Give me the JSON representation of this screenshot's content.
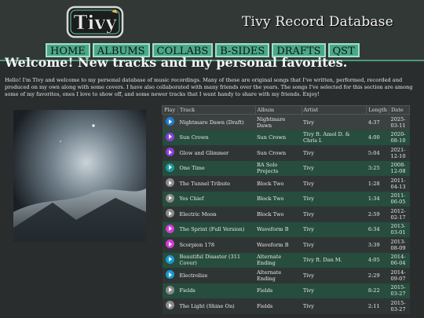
{
  "header": {
    "logo_text": "Tivy",
    "site_title": "Tivy Record Database",
    "nav": [
      "HOME",
      "ALBUMS",
      "COLLABS",
      "B-SIDES",
      "DRAFTS",
      "QST"
    ]
  },
  "welcome_heading": "Welcome! New tracks and my personal favorites.",
  "intro_text": "Hello! I'm Tivy and welcome to my personal database of music recordings. Many of these are original songs that I've written, performed, recorded and produced on my own along with some covers. I have also collaborated with many friends over the years. The songs I've selected for this section are among some of my favorites, ones I love to show off, and some newer tracks that I want handy to share with my friends. Enjoy!",
  "table": {
    "headers": [
      "Play",
      "Track",
      "Album",
      "Artist",
      "Length",
      "Date"
    ],
    "rows": [
      {
        "track": "Nightmare Dawn (Draft)",
        "album": "Nightmare Dawn",
        "artist": "Tivy",
        "length": "4:37",
        "date": "2025-03-11",
        "icon_color": "#1e7fd0",
        "icon": "cover-art-icon"
      },
      {
        "track": "Sun Crown",
        "album": "Sun Crown",
        "artist": "Tivy ft. Amol D. & Chris I.",
        "length": "4:00",
        "date": "2020-08-10",
        "icon_color": "#8a3fd6",
        "icon": "play-icon"
      },
      {
        "track": "Glow and Glimmer",
        "album": "Sun Crown",
        "artist": "Tivy",
        "length": "5:04",
        "date": "2021-12-10",
        "icon_color": "#8a3fd6",
        "icon": "play-icon"
      },
      {
        "track": "One Time",
        "album": "BA Solo Projects",
        "artist": "Tivy",
        "length": "3:25",
        "date": "2008-12-08",
        "icon_color": "#1a9a9a",
        "icon": "play-icon"
      },
      {
        "track": "The Tunnel Tribute",
        "album": "Block Two",
        "artist": "Tivy",
        "length": "1:28",
        "date": "2011-04-13",
        "icon_color": "#8a8a8a",
        "icon": "play-icon"
      },
      {
        "track": "Yes Chief",
        "album": "Block Two",
        "artist": "Tivy",
        "length": "1:34",
        "date": "2011-06-05",
        "icon_color": "#8a8a8a",
        "icon": "play-icon"
      },
      {
        "track": "Electric Moon",
        "album": "Block Two",
        "artist": "Tivy",
        "length": "2:59",
        "date": "2012-02-17",
        "icon_color": "#8a8a8a",
        "icon": "play-icon"
      },
      {
        "track": "The Sprint (Full Version)",
        "album": "Waveform B",
        "artist": "Tivy",
        "length": "6:34",
        "date": "2013-03-01",
        "icon_color": "#d43ad4",
        "icon": "play-icon"
      },
      {
        "track": "Scorpion 178",
        "album": "Waveform B",
        "artist": "Tivy",
        "length": "3:39",
        "date": "2013-08-09",
        "icon_color": "#d43ad4",
        "icon": "play-icon"
      },
      {
        "track": "Beautiful Disaster (311 Cover)",
        "album": "Alternate Ending",
        "artist": "Tivy ft. Dan M.",
        "length": "4:05",
        "date": "2014-06-04",
        "icon_color": "#1a9ad4",
        "icon": "play-icon"
      },
      {
        "track": "Electrolize",
        "album": "Alternate Ending",
        "artist": "Tivy",
        "length": "2:29",
        "date": "2014-09-07",
        "icon_color": "#1a9ad4",
        "icon": "play-icon"
      },
      {
        "track": "Fields",
        "album": "Fields",
        "artist": "Tivy",
        "length": "8:22",
        "date": "2015-03-27",
        "icon_color": "#8a8a8a",
        "icon": "play-icon"
      },
      {
        "track": "The Light (Shine On)",
        "album": "Fields",
        "artist": "Tivy",
        "length": "2:11",
        "date": "2015-03-27",
        "icon_color": "#8a8a8a",
        "icon": "play-icon"
      }
    ]
  }
}
